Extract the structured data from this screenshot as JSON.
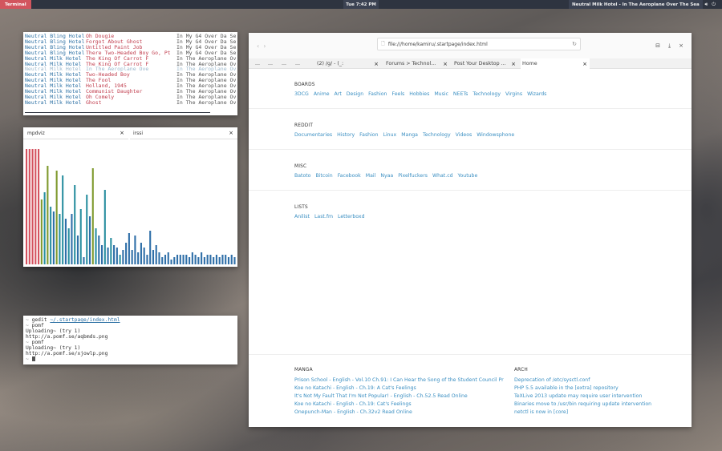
{
  "topbar": {
    "terminal_label": "Terminal",
    "clock": "Tue  7:42 PM",
    "now_playing": "Neutral Milk Hotel - In The Aeroplane Over The Sea",
    "volume_icon": "speaker-icon",
    "power_icon": "power-icon"
  },
  "ncmpcpp": {
    "tracks": [
      {
        "artist": "Neutral Bling Hotel",
        "title": "Oh Dougie",
        "album": "     In My G4 Over Da Sea"
      },
      {
        "artist": "Neutral Bling Hotel",
        "title": "Forgot About Ghost",
        "album": "     In My G4 Over Da Sea"
      },
      {
        "artist": "Neutral Bling Hotel",
        "title": "Untitled Paint Job",
        "album": "     In My G4 Over Da Sea"
      },
      {
        "artist": "Neutral Bling Hotel",
        "title": "There Two-Headed Boy Go, Pt",
        "album": "  In My G4 Over Da Sea"
      },
      {
        "artist": "Neutral Milk Hotel",
        "title": "The King Of Carrot F",
        "album": "In The Aeroplane Over The Sea"
      },
      {
        "artist": "Neutral Milk Hotel",
        "title": "The King Of Carrot F",
        "album": "In The Aeroplane Over The Sea"
      },
      {
        "artist": "Neutral Milk Hotel",
        "title": "In The Aeroplane Ove",
        "album": "In The Aeroplane Over The Sea",
        "current": true
      },
      {
        "artist": "Neutral Milk Hotel",
        "title": "Two-Headed Boy",
        "album": "In The Aeroplane Over The Sea"
      },
      {
        "artist": "Neutral Milk Hotel",
        "title": "The Fool",
        "album": "In The Aeroplane Over The Sea"
      },
      {
        "artist": "Neutral Milk Hotel",
        "title": "Holland, 1945",
        "album": "In The Aeroplane Over The Sea"
      },
      {
        "artist": "Neutral Milk Hotel",
        "title": "Communist Daughter",
        "album": "In The Aeroplane Over The Sea"
      },
      {
        "artist": "Neutral Milk Hotel",
        "title": "Oh Comely",
        "album": "In The Aeroplane Over The Sea"
      },
      {
        "artist": "Neutral Milk Hotel",
        "title": "Ghost",
        "album": "In The Aeroplane Over The Sea"
      }
    ]
  },
  "visualizer": {
    "tab1": "mpdviz",
    "tab2": "irssi",
    "close_icon": "close-icon",
    "colors": {
      "red": "#d4505e",
      "green": "#7f9a2e",
      "teal": "#2a8fa0",
      "blue": "#2f6fa8"
    },
    "bars": [
      {
        "h": 0.96,
        "c": "red"
      },
      {
        "h": 0.96,
        "c": "red"
      },
      {
        "h": 0.96,
        "c": "red"
      },
      {
        "h": 0.96,
        "c": "red"
      },
      {
        "h": 0.96,
        "c": "red"
      },
      {
        "h": 0.54,
        "c": "green"
      },
      {
        "h": 0.6,
        "c": "teal"
      },
      {
        "h": 0.82,
        "c": "green"
      },
      {
        "h": 0.48,
        "c": "teal"
      },
      {
        "h": 0.44,
        "c": "blue"
      },
      {
        "h": 0.78,
        "c": "green"
      },
      {
        "h": 0.42,
        "c": "teal"
      },
      {
        "h": 0.74,
        "c": "teal"
      },
      {
        "h": 0.38,
        "c": "blue"
      },
      {
        "h": 0.3,
        "c": "teal"
      },
      {
        "h": 0.42,
        "c": "blue"
      },
      {
        "h": 0.66,
        "c": "teal"
      },
      {
        "h": 0.24,
        "c": "blue"
      },
      {
        "h": 0.46,
        "c": "teal"
      },
      {
        "h": 0.06,
        "c": "blue"
      },
      {
        "h": 0.58,
        "c": "teal"
      },
      {
        "h": 0.4,
        "c": "blue"
      },
      {
        "h": 0.8,
        "c": "green"
      },
      {
        "h": 0.3,
        "c": "teal"
      },
      {
        "h": 0.24,
        "c": "blue"
      },
      {
        "h": 0.16,
        "c": "blue"
      },
      {
        "h": 0.62,
        "c": "teal"
      },
      {
        "h": 0.14,
        "c": "blue"
      },
      {
        "h": 0.22,
        "c": "teal"
      },
      {
        "h": 0.16,
        "c": "blue"
      },
      {
        "h": 0.14,
        "c": "blue"
      },
      {
        "h": 0.08,
        "c": "teal"
      },
      {
        "h": 0.12,
        "c": "blue"
      },
      {
        "h": 0.18,
        "c": "blue"
      },
      {
        "h": 0.26,
        "c": "blue"
      },
      {
        "h": 0.12,
        "c": "blue"
      },
      {
        "h": 0.24,
        "c": "blue"
      },
      {
        "h": 0.1,
        "c": "blue"
      },
      {
        "h": 0.18,
        "c": "blue"
      },
      {
        "h": 0.14,
        "c": "blue"
      },
      {
        "h": 0.08,
        "c": "blue"
      },
      {
        "h": 0.28,
        "c": "blue"
      },
      {
        "h": 0.12,
        "c": "blue"
      },
      {
        "h": 0.16,
        "c": "blue"
      },
      {
        "h": 0.1,
        "c": "blue"
      },
      {
        "h": 0.06,
        "c": "blue"
      },
      {
        "h": 0.08,
        "c": "blue"
      },
      {
        "h": 0.1,
        "c": "blue"
      },
      {
        "h": 0.04,
        "c": "blue"
      },
      {
        "h": 0.06,
        "c": "blue"
      },
      {
        "h": 0.08,
        "c": "blue"
      },
      {
        "h": 0.08,
        "c": "blue"
      },
      {
        "h": 0.08,
        "c": "blue"
      },
      {
        "h": 0.08,
        "c": "blue"
      },
      {
        "h": 0.06,
        "c": "blue"
      },
      {
        "h": 0.1,
        "c": "blue"
      },
      {
        "h": 0.08,
        "c": "blue"
      },
      {
        "h": 0.06,
        "c": "blue"
      },
      {
        "h": 0.1,
        "c": "blue"
      },
      {
        "h": 0.06,
        "c": "blue"
      },
      {
        "h": 0.08,
        "c": "blue"
      },
      {
        "h": 0.08,
        "c": "blue"
      },
      {
        "h": 0.06,
        "c": "blue"
      },
      {
        "h": 0.08,
        "c": "blue"
      },
      {
        "h": 0.06,
        "c": "blue"
      },
      {
        "h": 0.08,
        "c": "blue"
      },
      {
        "h": 0.08,
        "c": "blue"
      },
      {
        "h": 0.06,
        "c": "blue"
      },
      {
        "h": 0.08,
        "c": "blue"
      },
      {
        "h": 0.06,
        "c": "blue"
      }
    ]
  },
  "shell": {
    "lines": [
      {
        "prompt": "~ ",
        "cmd": "gedit ",
        "link": "~/.startpage/index.html"
      },
      {
        "prompt": "~ ",
        "cmd": "pomf"
      },
      {
        "text": "Uploading~ (try 1)"
      },
      {
        "text": "http://a.pomf.se/aqbmds.png"
      },
      {
        "prompt": "~ ",
        "cmd": "pomf"
      },
      {
        "text": "Uploading~ (try 1)"
      },
      {
        "text": "http://a.pomf.se/xjowlp.png"
      }
    ],
    "final_prompt": "~ "
  },
  "browser": {
    "url": "file:///home/kamiru/.startpage/index.html",
    "page_icon": "page-icon",
    "reload_icon": "reload-icon",
    "tabs": [
      {
        "label": "...",
        "close": ""
      },
      {
        "label": "...",
        "close": ""
      },
      {
        "label": "...",
        "close": ""
      },
      {
        "label": "...",
        "close": ""
      },
      {
        "label": "(2) /g/ - (_:",
        "close": "×"
      },
      {
        "label": "Forums > Technol...",
        "close": "×"
      },
      {
        "label": "Post Your Desktop ...",
        "close": "×"
      },
      {
        "label": "Home",
        "close": "×",
        "active": true
      }
    ],
    "sections": [
      {
        "title": "BOARDS",
        "links": [
          "3DCG",
          "Anime",
          "Art",
          "Design",
          "Fashion",
          "Feels",
          "Hobbies",
          "Music",
          "NEETs",
          "Technology",
          "Virgins",
          "Wizards"
        ]
      },
      {
        "title": "REDDIT",
        "links": [
          "Documentaries",
          "History",
          "Fashion",
          "Linux",
          "Manga",
          "Technology",
          "Videos",
          "Windowsphone"
        ]
      },
      {
        "title": "MISC",
        "links": [
          "Batoto",
          "Bitcoin",
          "Facebook",
          "Mail",
          "Nyaa",
          "Pixelfuckers",
          "What.cd",
          "Youtube"
        ]
      },
      {
        "title": "LISTS",
        "links": [
          "Anilist",
          "Last.fm",
          "Letterboxd"
        ]
      }
    ],
    "manga": {
      "title": "MANGA",
      "items": [
        "Prison School - English - Vol.10 Ch.91: I Can Hear the Song of the Student Council Pr",
        "Koe no Katachi - English - Ch.19: A Cat's Feelings",
        "It's Not My Fault That I'm Not Popular! - English - Ch.52.5 Read Online",
        "Koe no Katachi - English - Ch.19: Cat's Feelings",
        "Onepunch-Man - English - Ch.32v2 Read Online"
      ]
    },
    "arch": {
      "title": "ARCH",
      "items": [
        "Deprecation of /etc/sysctl.conf",
        "PHP 5.5 available in the [extra] repository",
        "TeXLive 2013 update may require user intervention",
        "Binaries move to /usr/bin requiring update intervention",
        "netctl is now in [core]"
      ]
    }
  }
}
